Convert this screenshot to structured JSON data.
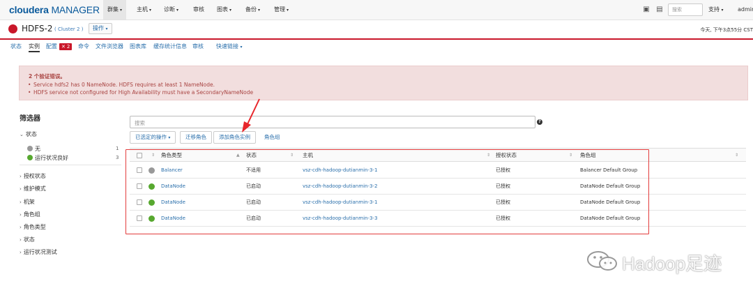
{
  "app": {
    "logo_brand": "cloudera",
    "logo_product": "MANAGER"
  },
  "topnav": {
    "menus": [
      "群集",
      "主机",
      "诊断",
      "审核",
      "图表",
      "备份",
      "管理"
    ],
    "search_placeholder": "搜索",
    "support": "支持",
    "user": "admin"
  },
  "service": {
    "name": "HDFS-2",
    "cluster": "( Cluster 2 )",
    "actions": "操作",
    "timestamp": "今天, 下午3点55分 CST",
    "status_color": "#c9172a"
  },
  "tabs": {
    "status": "状态",
    "instances": "实例",
    "config": "配置",
    "config_badge": "2",
    "commands": "命令",
    "file_browser": "文件浏览器",
    "charts": "图表库",
    "cache": "缓存统计信息",
    "audit": "审核",
    "quick_links": "快速链接"
  },
  "alert": {
    "title": "2 个验证错误。",
    "items": [
      "Service hdfs2 has 0 NameNode. HDFS requires at least 1 NameNode.",
      "HDFS service not configured for High Availability must have a SecondaryNameNode"
    ]
  },
  "filters": {
    "title": "筛选器",
    "status_group": "状态",
    "status_items": [
      {
        "label": "无",
        "count": "1",
        "color": "#999999"
      },
      {
        "label": "运行状况良好",
        "count": "3",
        "color": "#57a82f"
      }
    ],
    "groups": [
      "授权状态",
      "维护模式",
      "机架",
      "角色组",
      "角色类型",
      "状态",
      "运行状况测试"
    ]
  },
  "toolbar": {
    "search_placeholder": "搜索",
    "selected_actions": "已选定的操作",
    "migrate_role": "迁移角色",
    "add_role_instances": "添加角色实例",
    "role_groups": "角色组"
  },
  "table": {
    "headers": {
      "role_type": "角色类型",
      "state": "状态",
      "host": "主机",
      "commission": "授权状态",
      "role_group": "角色组"
    },
    "rows": [
      {
        "dot": "#999999",
        "role_type": "Balancer",
        "state": "不适用",
        "host": "vsz-cdh-hadoop-dutianmin-3-1",
        "commission": "已授权",
        "role_group": "Balancer Default Group"
      },
      {
        "dot": "#57a82f",
        "role_type": "DataNode",
        "state": "已启动",
        "host": "vsz-cdh-hadoop-dutianmin-3-2",
        "commission": "已授权",
        "role_group": "DataNode Default Group"
      },
      {
        "dot": "#57a82f",
        "role_type": "DataNode",
        "state": "已启动",
        "host": "vsz-cdh-hadoop-dutianmin-3-1",
        "commission": "已授权",
        "role_group": "DataNode Default Group"
      },
      {
        "dot": "#57a82f",
        "role_type": "DataNode",
        "state": "已启动",
        "host": "vsz-cdh-hadoop-dutianmin-3-3",
        "commission": "已授权",
        "role_group": "DataNode Default Group"
      }
    ]
  },
  "watermark": {
    "text": "Hadoop足迹"
  }
}
